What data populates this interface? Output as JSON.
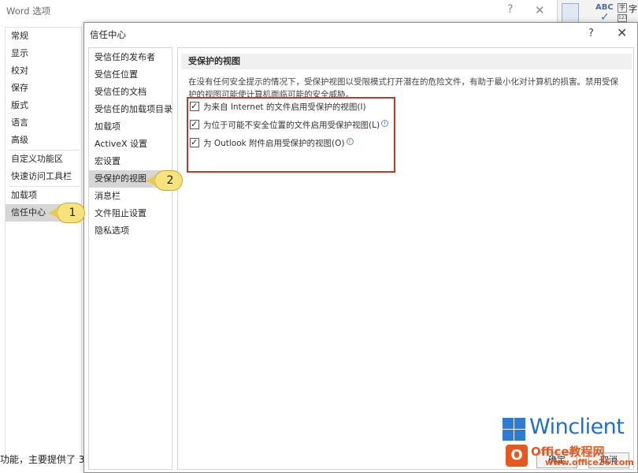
{
  "word_options": {
    "title": "Word 选项",
    "help": "?",
    "close": "✕",
    "nav": [
      {
        "label": "常规"
      },
      {
        "label": "显示"
      },
      {
        "label": "校对"
      },
      {
        "label": "保存"
      },
      {
        "label": "版式"
      },
      {
        "label": "语言"
      },
      {
        "label": "高级"
      },
      {
        "label": "自定义功能区"
      },
      {
        "label": "快速访问工具栏"
      },
      {
        "label": "加载项"
      },
      {
        "label": "信任中心",
        "selected": true
      }
    ],
    "footer_text": "功能，主要提供了 3"
  },
  "ribbon_strip": {
    "abc": "ABC",
    "zi": "字",
    "zi_small": "字",
    "zi_count": "123"
  },
  "trust_center": {
    "title": "信任中心",
    "help": "?",
    "close": "✕",
    "nav": [
      {
        "label": "受信任的发布者"
      },
      {
        "label": "受信任位置"
      },
      {
        "label": "受信任的文档"
      },
      {
        "label": "受信任的加载项目录"
      },
      {
        "label": "加载项"
      },
      {
        "label": "ActiveX 设置"
      },
      {
        "label": "宏设置"
      },
      {
        "label": "受保护的视图",
        "selected": true
      },
      {
        "label": "消息栏"
      },
      {
        "label": "文件阻止设置"
      },
      {
        "label": "隐私选项"
      }
    ],
    "section_title": "受保护的视图",
    "description": "在没有任何安全提示的情况下，受保护视图以受限模式打开潜在的危险文件，有助于最小化对计算机的损害。禁用受保护的视图可能使计算机面临可能的安全威胁。",
    "options": [
      {
        "label": "为来自 Internet 的文件启用受保护的视图(I)",
        "checked": true,
        "info": false
      },
      {
        "label": "为位于可能不安全位置的文件启用受保护视图(L)",
        "checked": true,
        "info": true
      },
      {
        "label": "为 Outlook 附件启用受保护的视图(O)",
        "checked": true,
        "info": true
      }
    ],
    "ok_label": "确定",
    "cancel_label": "取消"
  },
  "callouts": {
    "one": "1",
    "two": "2"
  },
  "watermark": {
    "brand": "Winclient",
    "office_site": "Office教程网",
    "url": "www.office26.com",
    "badge": "O",
    "color_blue": "#1f6fd1",
    "color_orange": "#e8571e"
  },
  "colors": {
    "selection": "#d6d6d6",
    "highlight_box": "#c0392b",
    "callout": "#f7e37c"
  }
}
